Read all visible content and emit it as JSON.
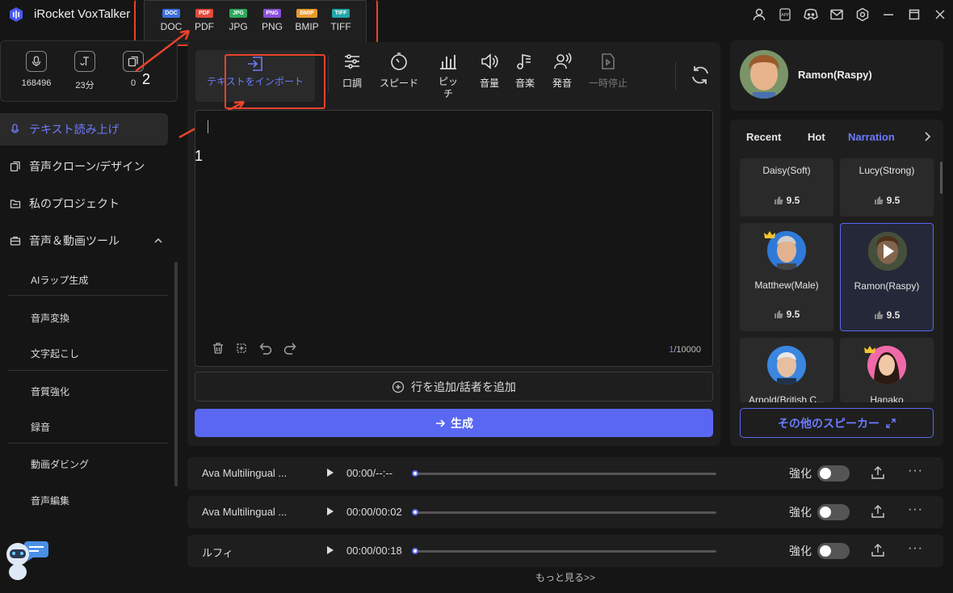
{
  "app": {
    "title": "iRocket VoxTalker"
  },
  "formats": [
    {
      "badge": "DOC",
      "label": "DOC",
      "color": "#3d6fe0"
    },
    {
      "badge": "PDF",
      "label": "PDF",
      "color": "#e04a3d"
    },
    {
      "badge": "JPG",
      "label": "JPG",
      "color": "#2ea85a"
    },
    {
      "badge": "PNG",
      "label": "PNG",
      "color": "#8a4fd8"
    },
    {
      "badge": "BMIP",
      "label": "BMIP",
      "color": "#e89a2c"
    },
    {
      "badge": "TIFF",
      "label": "TIFF",
      "color": "#21a8a8"
    }
  ],
  "annotations": {
    "one": "1",
    "two": "2"
  },
  "stats": [
    {
      "value": "168496"
    },
    {
      "value": "23分"
    },
    {
      "value": "0"
    }
  ],
  "nav": {
    "tts": "テキスト読み上げ",
    "clone": "音声クローン/デザイン",
    "projects": "私のプロジェクト",
    "tools": "音声＆動画ツール",
    "sub": [
      "AIラップ生成",
      "音声変換",
      "文字起こし",
      "音質強化",
      "録音",
      "動画ダビング",
      "音声編集"
    ]
  },
  "toolbar": {
    "import": "テキストをインポート",
    "tone": "口調",
    "speed": "スピード",
    "pitch": "ピッチ",
    "volume": "音量",
    "music": "音楽",
    "pronounce": "発音",
    "pause": "一時停止"
  },
  "editor": {
    "counter_cur": "1",
    "counter_max": "/10000"
  },
  "add_row": "行を追加/話者を追加",
  "generate": "生成",
  "speaker": {
    "name": "Ramon(Raspy)"
  },
  "tabs": [
    "Recent",
    "Hot",
    "Narration"
  ],
  "cards": [
    {
      "name": "Daisy(Soft)",
      "score": "9.5"
    },
    {
      "name": "Lucy(Strong)",
      "score": "9.5"
    },
    {
      "name": "Matthew(Male)",
      "score": "9.5"
    },
    {
      "name": "Ramon(Raspy)",
      "score": "9.5"
    },
    {
      "name": "Arnold(British C...",
      "score": ""
    },
    {
      "name": "Hanako",
      "score": ""
    }
  ],
  "more_speakers": "その他のスピーカー",
  "rows": [
    {
      "name": "Ava Multilingual ...",
      "time": "00:00/--:--",
      "enhance": "強化"
    },
    {
      "name": "Ava Multilingual ...",
      "time": "00:00/00:02",
      "enhance": "強化"
    },
    {
      "name": "ルフィ",
      "time": "00:00/00:18",
      "enhance": "強化"
    }
  ],
  "more_link": "もっと見る>>"
}
